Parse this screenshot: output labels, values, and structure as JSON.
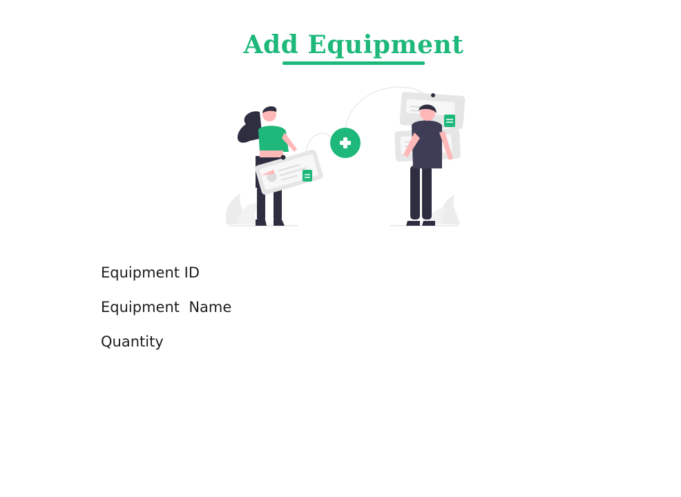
{
  "page": {
    "title": "Add Equipment"
  },
  "colors": {
    "accent": "#1db87a",
    "dark_figure": "#2f2e41",
    "card_grey": "#e6e6e6",
    "skin": "#ffb8b8"
  },
  "illustration": {
    "name": "add-item-illustration",
    "icon": "plus-circle-icon"
  },
  "form": {
    "labels": {
      "equipment_id": "Equipment ID",
      "equipment_name": "Equipment  Name",
      "quantity": "Quantity"
    }
  }
}
